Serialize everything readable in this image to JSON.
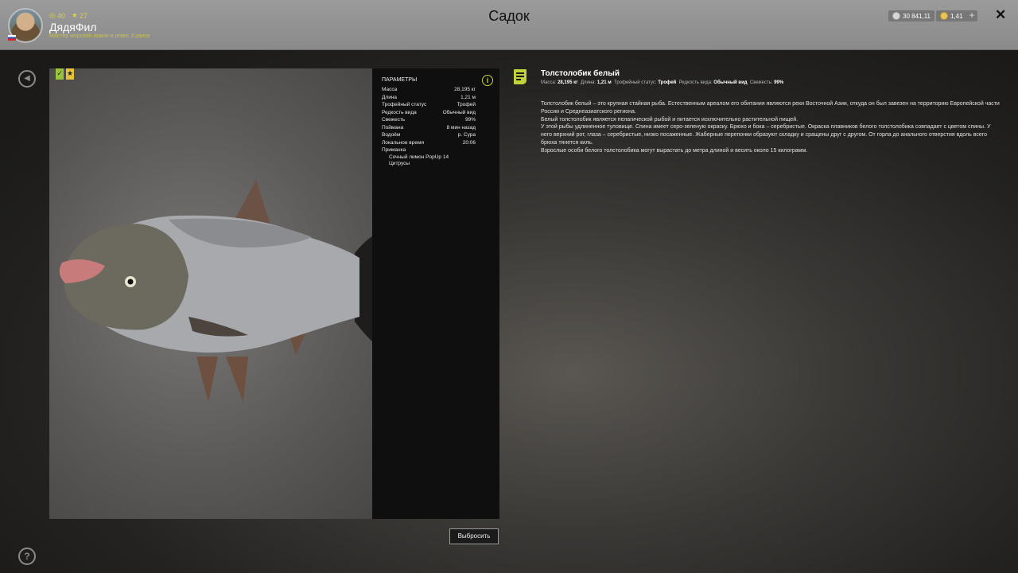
{
  "header": {
    "title": "Садок",
    "user": {
      "level": "40",
      "stars": "27",
      "name": "ДядяФил",
      "rank": "Мастер морской ловли в отвес 3 ранга"
    },
    "currency_silver": "30 841,11",
    "currency_gold": "1,41",
    "plus_label": "+",
    "close_label": "✕"
  },
  "params": {
    "title": "ПАРАМЕТРЫ",
    "rows": [
      {
        "label": "Масса",
        "value": "28,195 кг"
      },
      {
        "label": "Длина",
        "value": "1,21 м"
      },
      {
        "label": "Трофейный статус",
        "value": "Трофей"
      },
      {
        "label": "Редкость вида",
        "value": "Обычный вид"
      },
      {
        "label": "Свежесть",
        "value": "99%"
      },
      {
        "label": "Поймана",
        "value": "8 мин назад"
      },
      {
        "label": "Водоём",
        "value": "р. Сура"
      },
      {
        "label": "Локальное время",
        "value": "20:06"
      }
    ],
    "bait_label": "Приманка",
    "bait_items": [
      "Сочный лимон PopUp 14",
      "Цитрусы"
    ]
  },
  "discard_label": "Выбросить",
  "fish": {
    "name": "Толстолобик белый",
    "summary": {
      "mass_label": "Масса:",
      "mass": "28,195 кг",
      "length_label": "Длина:",
      "length": "1,21 м",
      "trophy_label": "Трофейный статус:",
      "trophy": "Трофей",
      "rarity_label": "Редкость вида:",
      "rarity": "Обычный вид",
      "fresh_label": "Свежесть:",
      "fresh": "99%"
    },
    "description": [
      "Толстолобик белый – это крупная стайная рыба. Естественным ареалом его обитания являются реки Восточной Азии, откуда он был завезен на территорию Европейской части России и Среднеазиатского региона.",
      "Белый толстолобик является пелагической рыбой и питается исключительно растительной пищей.",
      "У этой рыбы удлиненное туловище. Спина имеет серо-зеленую окраску. Брюхо и бока – серебристые. Окраска плавников белого толстолобика совпадает с цветом спины. У него верхний рот, глаза – серебристые, низко посаженные. Жаберные перепонки образуют складку и сращены друг с другом. От горла до анального отверстия вдоль всего брюха тянется киль.",
      "Взрослые особи белого толстолобика могут вырастать до метра длиной и весить около 15 килограмм."
    ]
  },
  "colors": {
    "accent": "#c3d13a",
    "header_bg": "#8f8f8f",
    "panel_bg": "#0f0f0f"
  }
}
